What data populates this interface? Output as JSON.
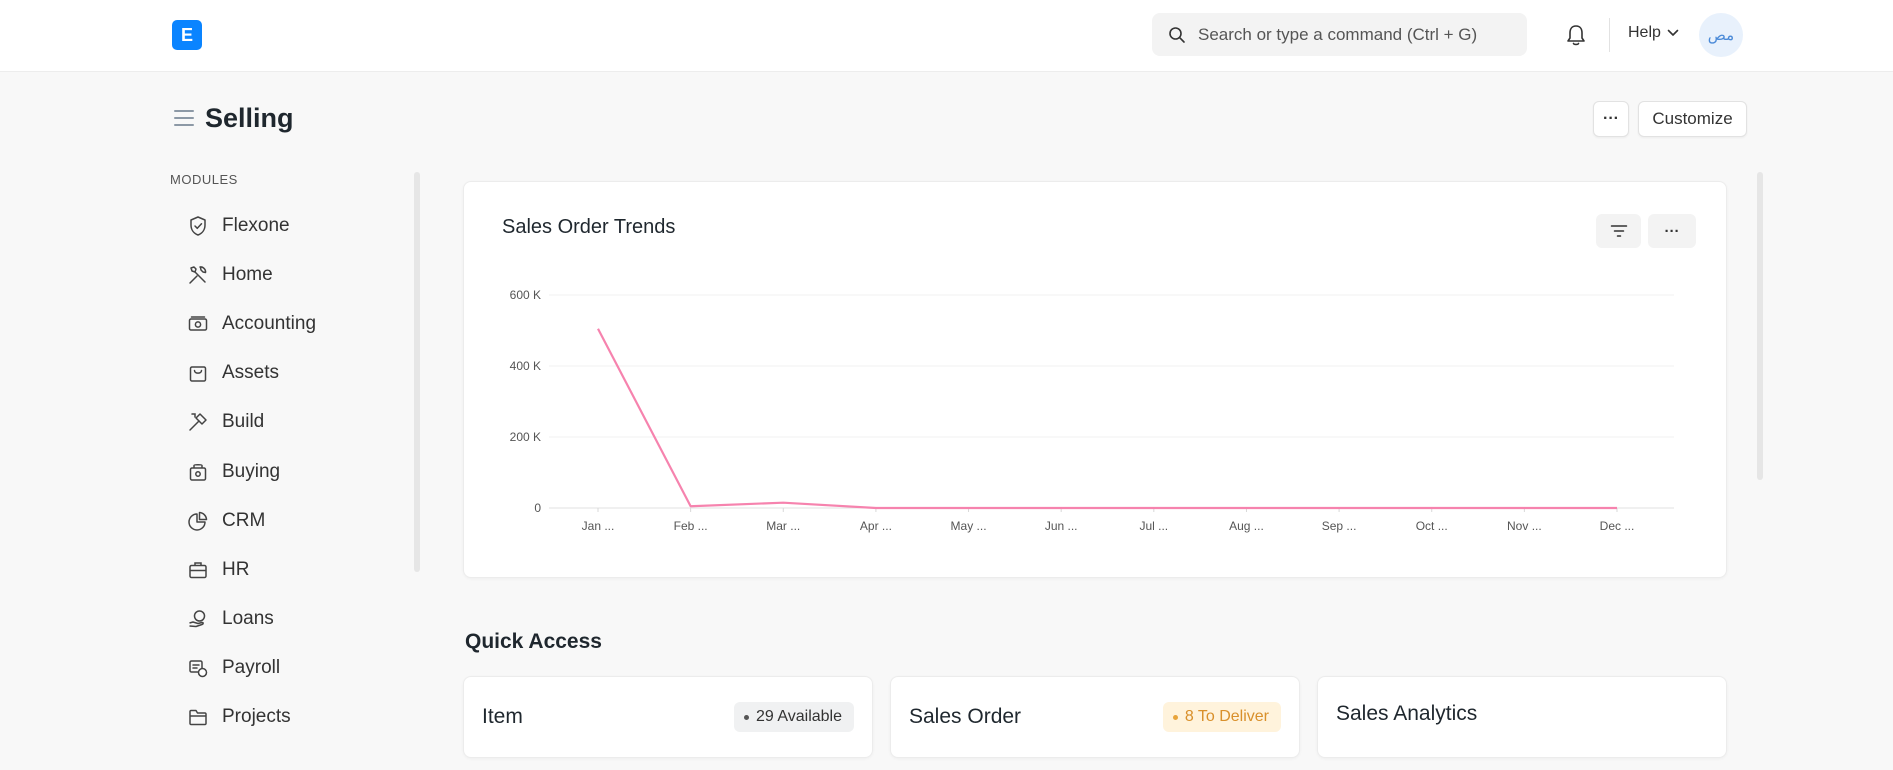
{
  "navbar": {
    "logo_letter": "E",
    "search_placeholder": "Search or type a command (Ctrl + G)",
    "help_label": "Help",
    "avatar_initials": "مص"
  },
  "page": {
    "title": "Selling",
    "more_label": "···",
    "customize_label": "Customize"
  },
  "sidebar": {
    "section_label": "MODULES",
    "items": [
      {
        "label": "Flexone",
        "icon": "shield-icon"
      },
      {
        "label": "Home",
        "icon": "tools-icon"
      },
      {
        "label": "Accounting",
        "icon": "money-icon"
      },
      {
        "label": "Assets",
        "icon": "bag-icon"
      },
      {
        "label": "Build",
        "icon": "hammer-icon"
      },
      {
        "label": "Buying",
        "icon": "basket-icon"
      },
      {
        "label": "CRM",
        "icon": "pie-chart-icon"
      },
      {
        "label": "HR",
        "icon": "briefcase-icon"
      },
      {
        "label": "Loans",
        "icon": "hand-coin-icon"
      },
      {
        "label": "Payroll",
        "icon": "payroll-icon"
      },
      {
        "label": "Projects",
        "icon": "folder-icon"
      }
    ]
  },
  "chart_card": {
    "more_label": "···"
  },
  "chart_data": {
    "type": "line",
    "title": "Sales Order Trends",
    "categories": [
      "Jan ...",
      "Feb ...",
      "Mar ...",
      "Apr ...",
      "May ...",
      "Jun ...",
      "Jul ...",
      "Aug ...",
      "Sep ...",
      "Oct ...",
      "Nov ...",
      "Dec ..."
    ],
    "series": [
      {
        "values": [
          505000,
          5000,
          15000,
          0,
          0,
          0,
          0,
          0,
          0,
          0,
          0,
          0
        ],
        "color": "#f683ae"
      }
    ],
    "ylim": [
      0,
      600000
    ],
    "yticks": [
      0,
      200000,
      400000,
      600000
    ],
    "ytick_labels": [
      "0",
      "200 K",
      "400 K",
      "600 K"
    ],
    "grid": true
  },
  "quick_access": {
    "title": "Quick Access",
    "cards": [
      {
        "name": "Item",
        "badge": "29 Available",
        "badge_bg": "#f0f1f2",
        "badge_color": "#333333",
        "dot_color": "#555555"
      },
      {
        "name": "Sales Order",
        "badge": "8 To Deliver",
        "badge_bg": "#fff3dc",
        "badge_color": "#d9902b",
        "dot_color": "#e8a43b"
      },
      {
        "name": "Sales Analytics"
      }
    ]
  }
}
